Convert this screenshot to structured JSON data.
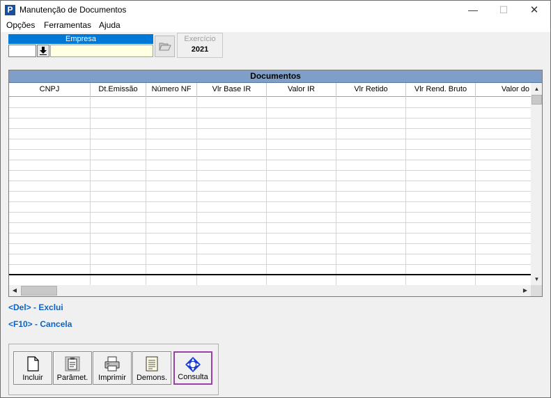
{
  "window": {
    "title": "Manutenção de Documentos",
    "minimize": "—",
    "maximize": "☐",
    "close": "✕",
    "app_icon": "P"
  },
  "menu": [
    "Opções",
    "Ferramentas",
    "Ajuda"
  ],
  "empresa": {
    "label": "Empresa",
    "code": "",
    "name": ""
  },
  "exercicio": {
    "label": "Exercício",
    "year": "2021"
  },
  "grid": {
    "title": "Documentos",
    "columns": [
      "CNPJ",
      "Dt.Emissão",
      "Número NF",
      "Vlr Base IR",
      "Valor IR",
      "Vlr Retido",
      "Vlr Rend. Bruto",
      "Valor do"
    ]
  },
  "hints": {
    "delete": "<Del> - Exclui",
    "cancel": "<F10> - Cancela"
  },
  "toolbar": [
    {
      "label": "Incluir",
      "icon": "new-document-icon"
    },
    {
      "label": "Parâmet.",
      "icon": "parameters-icon"
    },
    {
      "label": "Imprimir",
      "icon": "printer-icon"
    },
    {
      "label": "Demons.",
      "icon": "report-icon"
    },
    {
      "label": "Consulta",
      "icon": "query-icon"
    }
  ],
  "colors": {
    "accent": "#0078d7",
    "grid_title": "#7f9fc8",
    "hint_text": "#0a64c8",
    "active_border": "#9b3ea8"
  }
}
